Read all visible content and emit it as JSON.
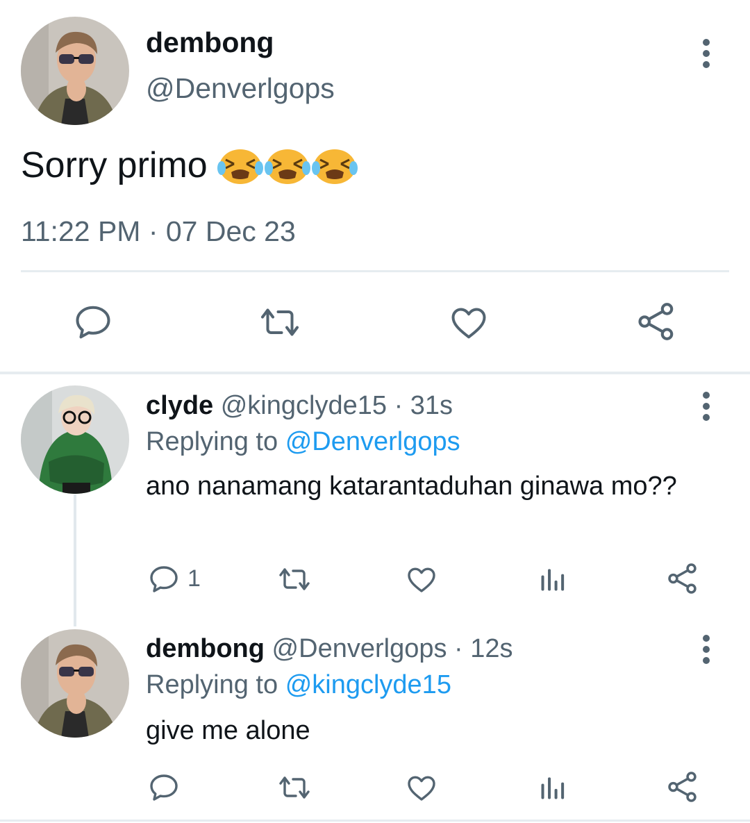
{
  "tweet": {
    "display_name": "dembong",
    "handle": "@Denverlgops",
    "text": "Sorry primo",
    "emoji": "😭😭😭",
    "timestamp": "11:22 PM · 07 Dec 23"
  },
  "replies": [
    {
      "display_name": "clyde",
      "handle": "@kingclyde15",
      "age": "· 31s",
      "replying_label": "Replying to",
      "replying_to": "@Denverlgops",
      "text": "ano nanamang katarantaduhan ginawa mo??",
      "reply_count": "1"
    },
    {
      "display_name": "dembong",
      "handle": "@Denverlgops",
      "age": "· 12s",
      "replying_label": "Replying to",
      "replying_to": "@kingclyde15",
      "text": "give me alone",
      "reply_count": ""
    }
  ],
  "colors": {
    "text": "#0f1419",
    "secondary": "#536471",
    "link": "#1d9bf0",
    "divider": "#e6ecf0"
  },
  "icons": [
    "more-icon",
    "reply-icon",
    "retweet-icon",
    "like-icon",
    "share-icon",
    "views-icon",
    "crying-emoji"
  ]
}
